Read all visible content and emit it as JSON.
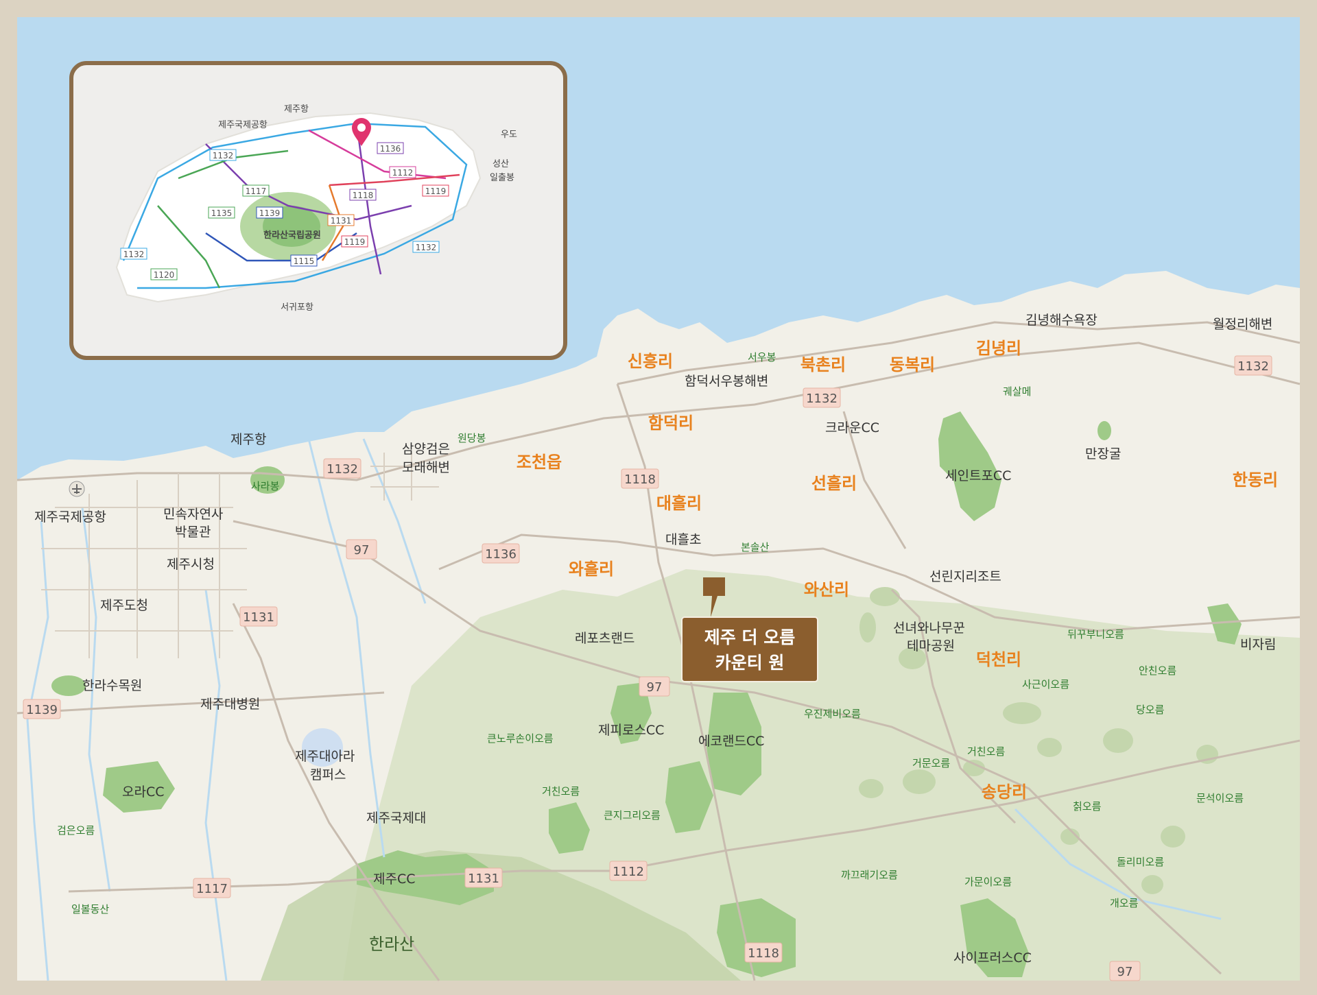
{
  "colors": {
    "frame": "#dcd3c2",
    "sea": "#b9daf0",
    "land": "#f2f0e8",
    "hill": "#c9d8b4",
    "forest": "#9fca88",
    "road": "#c8bcaf",
    "village_label": "#e8811d",
    "callout": "#8b5e2e",
    "pin": "#e0336e"
  },
  "callout": {
    "line1": "제주 더 오름",
    "line2": "카운티 원"
  },
  "villages": [
    {
      "name": "신흥리"
    },
    {
      "name": "북촌리"
    },
    {
      "name": "동복리"
    },
    {
      "name": "김녕리"
    },
    {
      "name": "함덕리"
    },
    {
      "name": "조천읍"
    },
    {
      "name": "대흘리"
    },
    {
      "name": "선흘리"
    },
    {
      "name": "한동리"
    },
    {
      "name": "와흘리"
    },
    {
      "name": "와산리"
    },
    {
      "name": "덕천리"
    },
    {
      "name": "송당리"
    }
  ],
  "places": [
    {
      "name": "김녕해수욕장"
    },
    {
      "name": "월정리해변"
    },
    {
      "name": "서우봉"
    },
    {
      "name": "함덕서우봉해변"
    },
    {
      "name": "제주항"
    },
    {
      "name": "삼양검은"
    },
    {
      "name": "모래해변"
    },
    {
      "name": "원당봉"
    },
    {
      "name": "크라운CC"
    },
    {
      "name": "궤살메"
    },
    {
      "name": "만장굴"
    },
    {
      "name": "세인트포CC"
    },
    {
      "name": "제주국제공항"
    },
    {
      "name": "민속자연사"
    },
    {
      "name": "박물관"
    },
    {
      "name": "사라봉"
    },
    {
      "name": "대흘초"
    },
    {
      "name": "본솔산"
    },
    {
      "name": "선린지리조트"
    },
    {
      "name": "제주시청"
    },
    {
      "name": "제주도청"
    },
    {
      "name": "레포츠랜드"
    },
    {
      "name": "선녀와나무꾼"
    },
    {
      "name": "테마공원"
    },
    {
      "name": "뒤꾸부니오름"
    },
    {
      "name": "비자림"
    },
    {
      "name": "한라수목원"
    },
    {
      "name": "제주대병원"
    },
    {
      "name": "사근이오름"
    },
    {
      "name": "안친오름"
    },
    {
      "name": "우진제비오름"
    },
    {
      "name": "당오름"
    },
    {
      "name": "제피로스CC"
    },
    {
      "name": "에코랜드CC"
    },
    {
      "name": "큰노루손이오름"
    },
    {
      "name": "제주대아라"
    },
    {
      "name": "캠퍼스"
    },
    {
      "name": "거문오름"
    },
    {
      "name": "거친오름"
    },
    {
      "name": "오라CC"
    },
    {
      "name": "거친오름"
    },
    {
      "name": "큰지그리오름"
    },
    {
      "name": "문석이오름"
    },
    {
      "name": "송당리"
    },
    {
      "name": "제주국제대"
    },
    {
      "name": "칡오름"
    },
    {
      "name": "검은오름"
    },
    {
      "name": "돌리미오름"
    },
    {
      "name": "제주CC"
    },
    {
      "name": "까끄래기오름"
    },
    {
      "name": "가문이오름"
    },
    {
      "name": "개오름"
    },
    {
      "name": "일볼동산"
    },
    {
      "name": "한라산"
    },
    {
      "name": "사이프러스CC"
    }
  ],
  "roads": [
    {
      "num": "1132"
    },
    {
      "num": "1132"
    },
    {
      "num": "1132"
    },
    {
      "num": "1118"
    },
    {
      "num": "97"
    },
    {
      "num": "1136"
    },
    {
      "num": "1131"
    },
    {
      "num": "97"
    },
    {
      "num": "1139"
    },
    {
      "num": "1117"
    },
    {
      "num": "1131"
    },
    {
      "num": "1112"
    },
    {
      "num": "1118"
    },
    {
      "num": "97"
    }
  ],
  "inset": {
    "places": [
      {
        "name": "제주항"
      },
      {
        "name": "제주국제공항"
      },
      {
        "name": "우도"
      },
      {
        "name": "성산"
      },
      {
        "name": "일출봉"
      },
      {
        "name": "한라산국립공원"
      },
      {
        "name": "서귀포항"
      }
    ],
    "roads": [
      {
        "num": "1132"
      },
      {
        "num": "1136"
      },
      {
        "num": "1112"
      },
      {
        "num": "1119"
      },
      {
        "num": "1117"
      },
      {
        "num": "1118"
      },
      {
        "num": "1135"
      },
      {
        "num": "1139"
      },
      {
        "num": "1131"
      },
      {
        "num": "1119"
      },
      {
        "num": "1132"
      },
      {
        "num": "1132"
      },
      {
        "num": "1115"
      },
      {
        "num": "1120"
      }
    ]
  }
}
